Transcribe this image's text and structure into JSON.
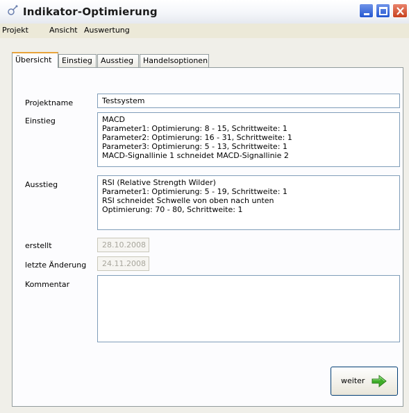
{
  "window": {
    "title": "Indikator-Optimierung"
  },
  "menu": [
    "Projekt",
    "Ansicht",
    "Auswertung"
  ],
  "tabs": [
    "Übersicht",
    "Einstieg",
    "Ausstieg",
    "Handelsoptionen"
  ],
  "active_tab": "Übersicht",
  "form": {
    "projektname_label": "Projektname",
    "projektname_value": "Testsystem",
    "einstieg_label": "Einstieg",
    "einstieg_value": "MACD\nParameter1: Optimierung: 8 - 15, Schrittweite: 1\nParameter2: Optimierung: 16 - 31, Schrittweite: 1\nParameter3: Optimierung: 5 - 13, Schrittweite: 1\nMACD-Signallinie 1 schneidet MACD-Signallinie 2",
    "ausstieg_label": "Ausstieg",
    "ausstieg_value": "RSI (Relative Strength Wilder)\nParameter1: Optimierung: 5 - 19, Schrittweite: 1\nRSI schneidet Schwelle von oben nach unten\nOptimierung: 70 - 80, Schrittweite: 1",
    "erstellt_label": "erstellt",
    "erstellt_value": "28.10.2008",
    "letzte_label": "letzte Änderung",
    "letzte_value": "24.11.2008",
    "kommentar_label": "Kommentar",
    "kommentar_value": ""
  },
  "buttons": {
    "weiter": "weiter"
  },
  "colors": {
    "accent_tab": "#e8a33a",
    "arrow_green": "#3fae2a"
  }
}
